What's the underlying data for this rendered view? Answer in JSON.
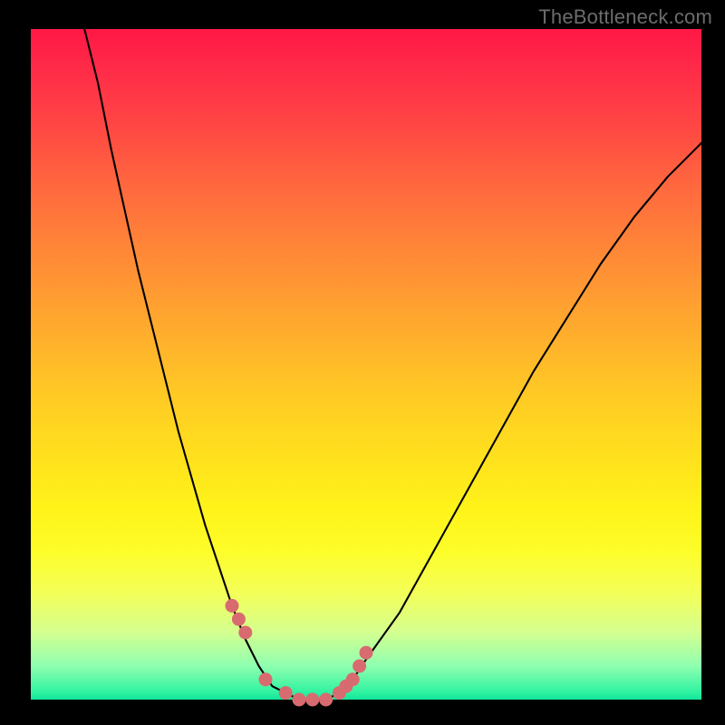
{
  "watermark": "TheBottleneck.com",
  "colors": {
    "frame": "#000000",
    "curve": "#000000",
    "marker": "#d86b6f",
    "gradient_top": "#ff1846",
    "gradient_bottom": "#12e39b"
  },
  "chart_data": {
    "type": "line",
    "title": "",
    "xlabel": "",
    "ylabel": "",
    "xlim": [
      0,
      100
    ],
    "ylim": [
      0,
      100
    ],
    "series": [
      {
        "name": "bottleneck-curve",
        "x": [
          8,
          10,
          12,
          14,
          16,
          18,
          20,
          22,
          24,
          26,
          28,
          30,
          32,
          34,
          36,
          38,
          40,
          42,
          44,
          46,
          48,
          50,
          55,
          60,
          65,
          70,
          75,
          80,
          85,
          90,
          95,
          100
        ],
        "y": [
          100,
          92,
          82,
          73,
          64,
          56,
          48,
          40,
          33,
          26,
          20,
          14,
          9,
          5,
          2,
          1,
          0,
          0,
          0,
          1,
          3,
          6,
          13,
          22,
          31,
          40,
          49,
          57,
          65,
          72,
          78,
          83
        ]
      }
    ],
    "markers": {
      "name": "highlight-dots",
      "x": [
        30,
        31,
        32,
        35,
        38,
        40,
        42,
        44,
        46,
        47,
        48,
        49,
        50
      ],
      "y": [
        14,
        12,
        10,
        3,
        1,
        0,
        0,
        0,
        1,
        2,
        3,
        5,
        7
      ]
    }
  }
}
